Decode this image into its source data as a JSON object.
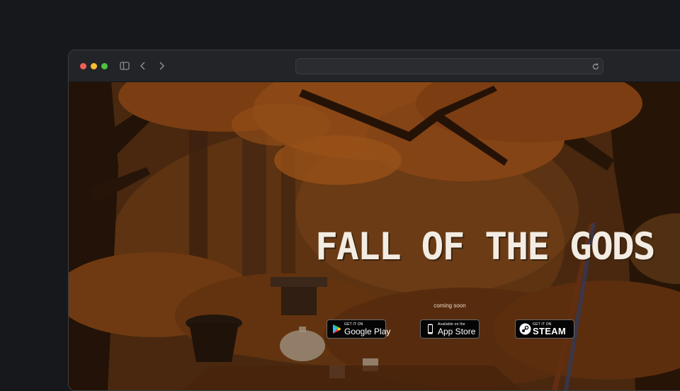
{
  "browser": {
    "url": ""
  },
  "hero": {
    "title": "FALL OF THE GODS",
    "tagline": "coming soon"
  },
  "stores": [
    {
      "small": "GET IT ON",
      "large": "Google Play",
      "icon": "google-play-icon"
    },
    {
      "small": "Available on the",
      "large": "App Store",
      "icon": "apple-icon"
    },
    {
      "small": "GET IT ON",
      "large": "STEAM",
      "icon": "steam-icon"
    }
  ],
  "colors": {
    "page_bg": "#17181b",
    "title": "#f3ece2",
    "badge_bg": "#050505",
    "autumn_orange": "#c8641e"
  }
}
